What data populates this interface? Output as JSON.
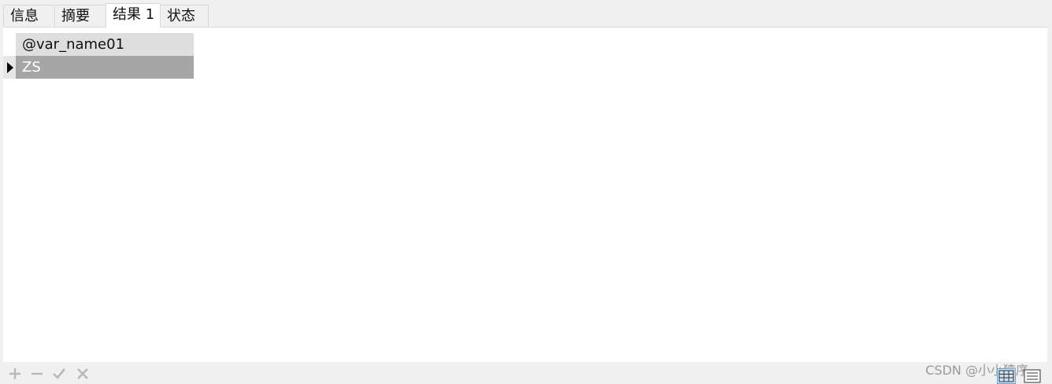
{
  "tabs": [
    {
      "label": "信息"
    },
    {
      "label": "摘要"
    },
    {
      "label": "结果 1",
      "active": true
    },
    {
      "label": "状态"
    }
  ],
  "result_grid": {
    "columns": [
      "@var_name01"
    ],
    "rows": [
      [
        "ZS"
      ]
    ],
    "selected_row": 0
  },
  "toolbar": {
    "add_icon": "plus-icon",
    "remove_icon": "minus-icon",
    "apply_icon": "check-icon",
    "discard_icon": "x-icon",
    "grid_view_icon": "grid-view-icon",
    "form_view_icon": "form-view-icon"
  },
  "watermark": "CSDN @小小猿序",
  "colors": {
    "header_bg": "#dedede",
    "selected_cell_bg": "#a6a6a6",
    "selected_cell_text": "#ffffff",
    "disabled_icon": "#b8b8b8"
  }
}
